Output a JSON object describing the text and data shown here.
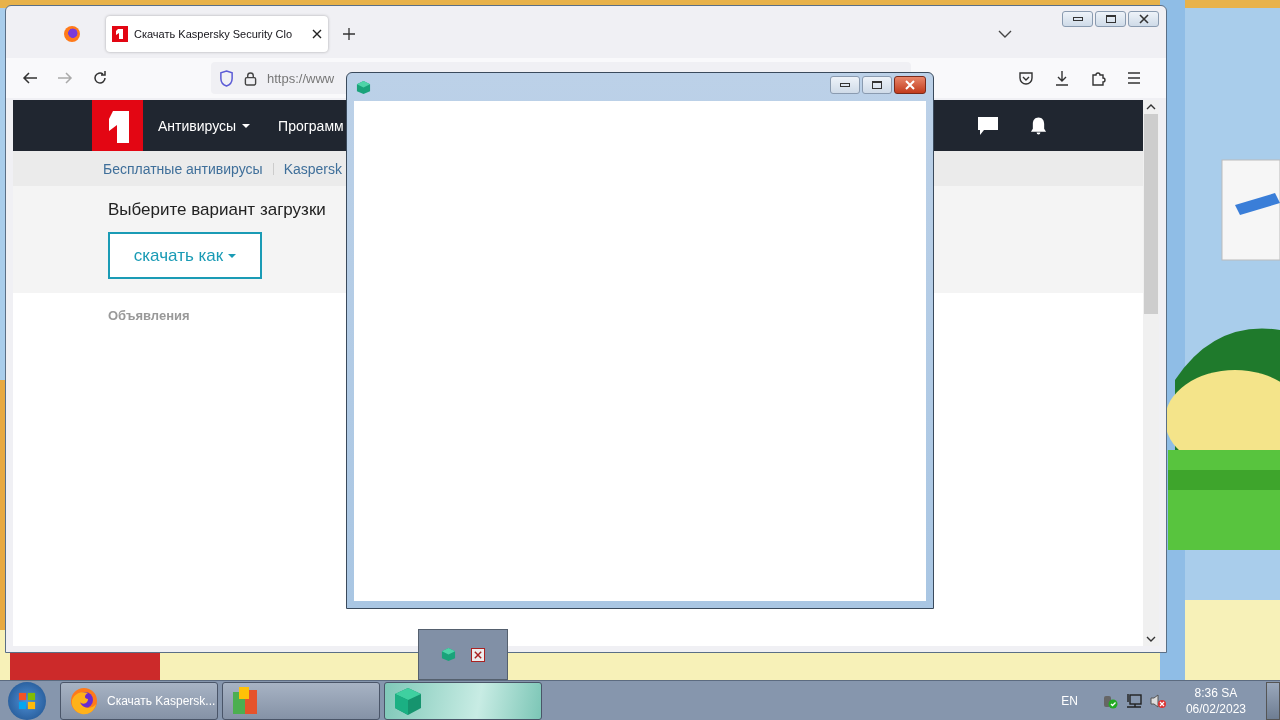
{
  "browser": {
    "tabs": [
      {
        "title": "Скачать Kaspersky Security Clo",
        "selected": true
      }
    ],
    "address": "https://www",
    "site": {
      "nav": [
        {
          "label": "Антивирусы",
          "dropdown": true
        },
        {
          "label": "Программ",
          "dropdown": false
        }
      ],
      "breadcrumbs": [
        "Бесплатные антивирусы",
        "Kaspersk"
      ],
      "heading": "Выберите вариант загрузки",
      "download_button": "скачать как",
      "ads_label": "Объявления"
    }
  },
  "taskbar": {
    "buttons": [
      {
        "kind": "firefox",
        "label": "Скачать Kaspersk...",
        "active": false
      },
      {
        "kind": "avg",
        "active": false
      },
      {
        "kind": "cube",
        "active": true
      }
    ],
    "language": "EN",
    "time": "8:36 SA",
    "date": "06/02/2023"
  }
}
